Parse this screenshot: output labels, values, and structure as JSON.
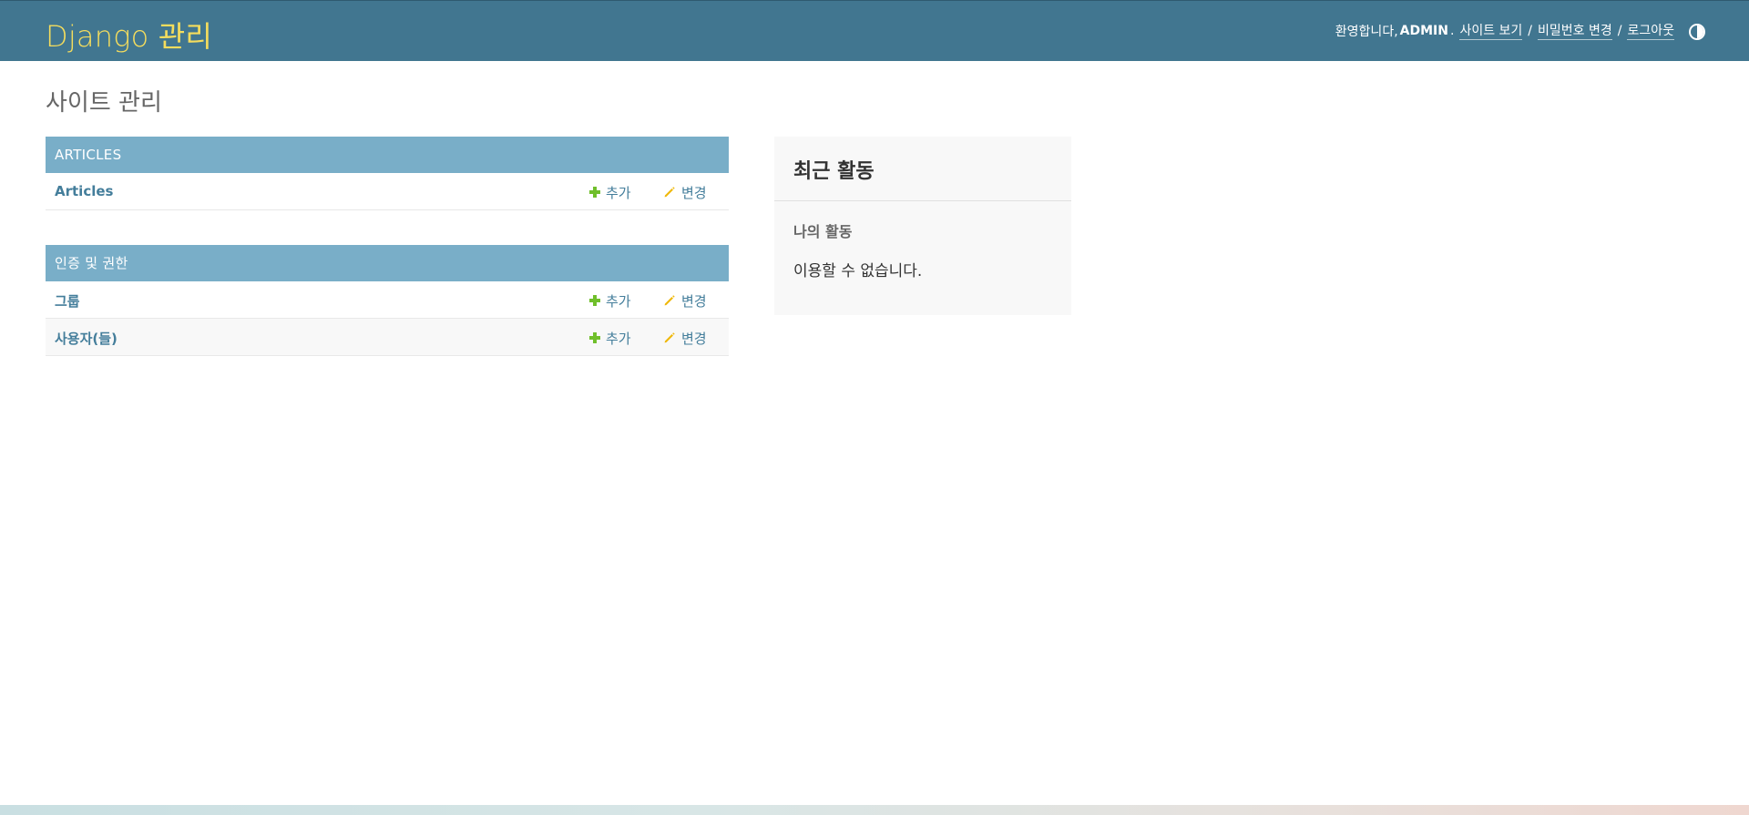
{
  "header": {
    "brand": "Django 관리",
    "welcome": "환영합니다,",
    "username": "ADMIN",
    "period": ".",
    "links": {
      "view_site": "사이트 보기",
      "change_password": "비밀번호 변경",
      "logout": "로그아웃"
    },
    "separator": "/"
  },
  "page": {
    "title": "사이트 관리"
  },
  "apps": [
    {
      "caption": "ARTICLES",
      "models": [
        {
          "name": "Articles",
          "add": "추가",
          "change": "변경"
        }
      ]
    },
    {
      "caption": "인증 및 권한",
      "models": [
        {
          "name": "그룹",
          "add": "추가",
          "change": "변경"
        },
        {
          "name": "사용자(들)",
          "add": "추가",
          "change": "변경"
        }
      ]
    }
  ],
  "recent_actions": {
    "title": "최근 활동",
    "subtitle": "나의 활동",
    "empty": "이용할 수 없습니다."
  },
  "colors": {
    "header_bg": "#417690",
    "brand": "#f5dd5d",
    "caption_bg": "#79aec8",
    "link": "#447e9b",
    "add_icon": "#70bf2b",
    "change_icon": "#efb80b"
  }
}
